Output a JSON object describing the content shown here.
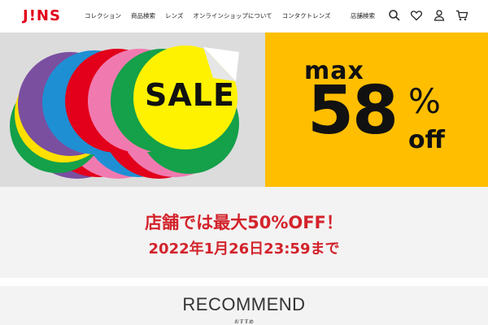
{
  "header": {
    "logo": "J!NS",
    "nav": [
      "コレクション",
      "商品検索",
      "レンズ",
      "オンラインショップについて",
      "コンタクトレンズ"
    ],
    "store_search": "店舗検索",
    "icons": [
      "search-icon",
      "heart-icon",
      "user-icon",
      "cart-icon"
    ]
  },
  "banner": {
    "sale_text": "SALE",
    "max_text": "max",
    "big_number": "58",
    "percent": "%",
    "off_text": "off",
    "colors": {
      "yellow": "#ffbe00",
      "grey": "#dcdcdc"
    }
  },
  "notice": {
    "line1": "店舗では最大50%OFF！",
    "line2": "2022年1月26日23:59まで",
    "color": "#d3232b"
  },
  "recommend": {
    "title": "RECOMMEND",
    "subtitle": "おすすめ"
  }
}
